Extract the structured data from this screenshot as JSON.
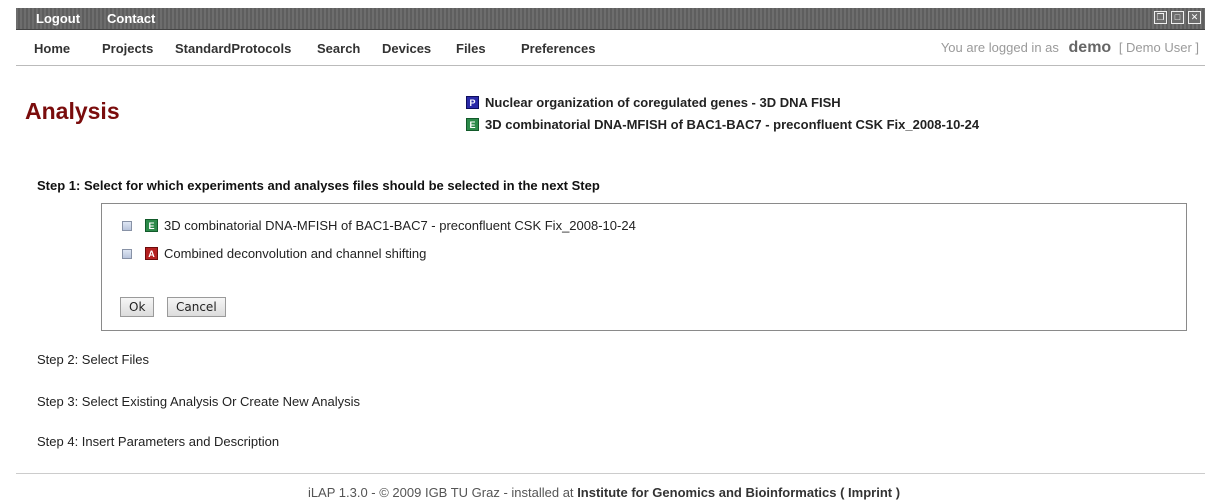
{
  "topbar": {
    "logout": "Logout",
    "contact": "Contact"
  },
  "window_icons": [
    "restore-icon",
    "maximize-icon",
    "close-icon"
  ],
  "nav": {
    "items": [
      "Home",
      "Projects",
      "StandardProtocols",
      "Search",
      "Devices",
      "Files",
      "Preferences"
    ],
    "login_prefix": "You are logged in as",
    "username": "demo",
    "fullname": "[ Demo User ]"
  },
  "page": {
    "title": "Analysis",
    "project_badge": "P",
    "project": "Nuclear organization of coregulated genes - 3D DNA FISH",
    "experiment_badge": "E",
    "experiment": "3D combinatorial DNA-MFISH of BAC1-BAC7 - preconfluent CSK Fix_2008-10-24"
  },
  "step1": {
    "title": "Step 1: Select for which experiments and analyses files should be selected in the next Step",
    "items": [
      {
        "badge": "E",
        "label": "3D combinatorial DNA-MFISH of BAC1-BAC7 - preconfluent CSK Fix_2008-10-24"
      },
      {
        "badge": "A",
        "label": "Combined deconvolution and channel shifting"
      }
    ],
    "ok": "Ok",
    "cancel": "Cancel"
  },
  "steps": [
    "Step 2: Select Files",
    "Step 3: Select Existing Analysis Or Create New Analysis",
    "Step 4: Insert Parameters and Description"
  ],
  "footer": {
    "prefix": "iLAP 1.3.0 - © 2009 IGB TU Graz - installed at",
    "institute": "Institute for Genomics and Bioinformatics ( Imprint )"
  },
  "colors": {
    "title": "#7a0c0c",
    "project_badge": "#2a2aa8",
    "experiment_badge": "#2c8a4a",
    "analysis_badge": "#b52020"
  }
}
